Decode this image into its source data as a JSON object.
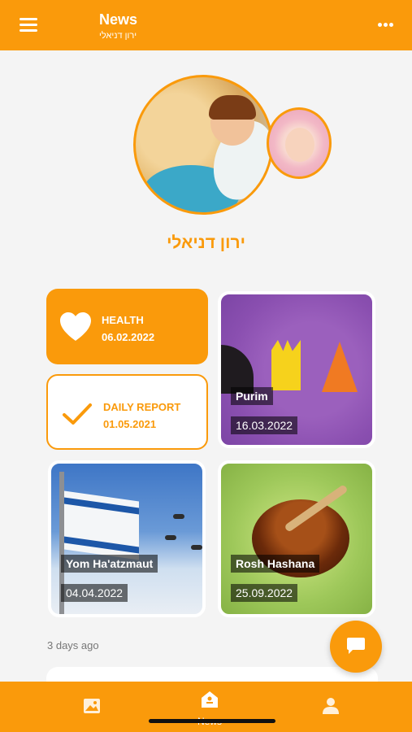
{
  "header": {
    "title": "News",
    "subtitle": "ירון דניאלי",
    "menu_icon": "hamburger-icon",
    "more_icon": "more-dots-icon"
  },
  "profile": {
    "name": "ירון דניאלי"
  },
  "cards": {
    "health": {
      "title": "HEALTH",
      "date": "06.02.2022",
      "icon": "heart-icon"
    },
    "daily_report": {
      "title": "DAILY REPORT",
      "date": "01.05.2021",
      "icon": "checkmark-icon"
    }
  },
  "events": [
    {
      "label": "Purim",
      "date": "16.03.2022"
    },
    {
      "label": "Yom Ha'atzmaut",
      "date": "04.04.2022"
    },
    {
      "label": "Rosh Hashana",
      "date": "25.09.2022"
    }
  ],
  "feed": {
    "timestamp": "3 days ago"
  },
  "fab": {
    "icon": "chat-icon"
  },
  "bottom_nav": {
    "items": [
      {
        "icon": "gallery-icon",
        "label": ""
      },
      {
        "icon": "home-icon",
        "label": "News"
      },
      {
        "icon": "person-icon",
        "label": ""
      }
    ]
  },
  "colors": {
    "accent": "#fa9a0b",
    "background": "#f4f4f4"
  }
}
